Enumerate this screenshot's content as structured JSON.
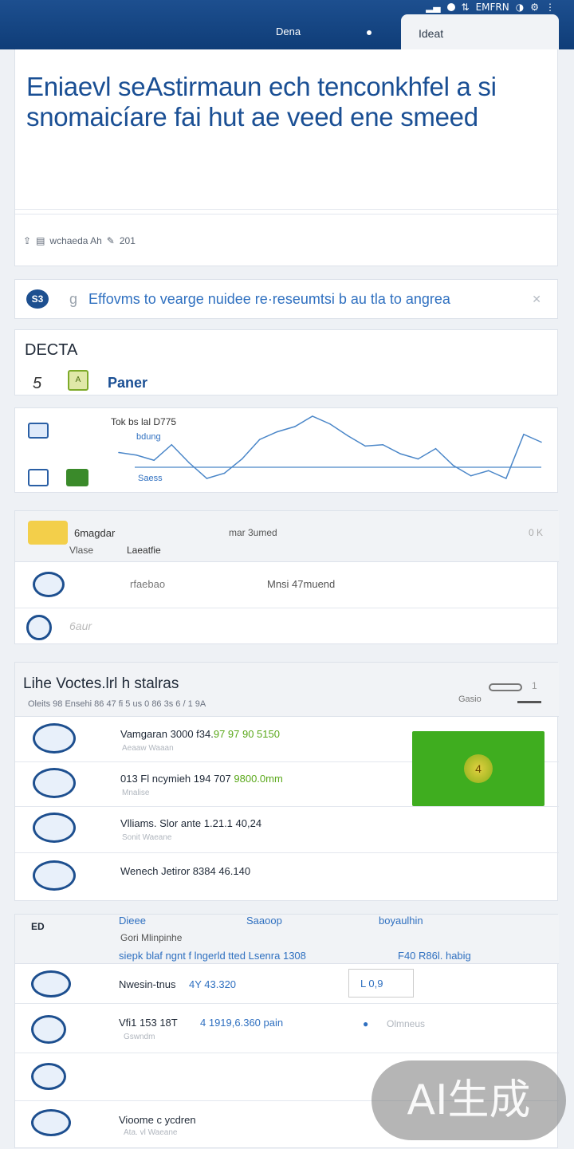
{
  "topbar": {
    "status_text": "EMFRN",
    "tab_demo": "Dena",
    "tab_active": "Ideat"
  },
  "hero": {
    "title": "Eniaevl seAstirmaun ech tenconkhfel a si snomaicíare fai hut ae veed ene smeed",
    "meta": "wchaeda Ah",
    "meta_count": "201"
  },
  "banner": {
    "icon": "S3",
    "g": "g",
    "text": "Effovms to vearge nuidee re·reseumtsi b au tla to angrea"
  },
  "delta": {
    "title": "DECTA",
    "count": "5",
    "panel_label": "Paner"
  },
  "mini_chart": {
    "label": "Tok bs lal D775",
    "sub": "bdung",
    "foot": "Saess",
    "chart_data": {
      "type": "line",
      "series": [
        {
          "values": [
            30,
            28,
            24,
            36,
            22,
            10,
            14,
            25,
            40,
            46,
            50,
            58,
            52,
            43,
            35,
            36,
            29,
            25,
            33,
            20,
            12,
            16,
            10,
            44,
            38
          ]
        }
      ]
    }
  },
  "filter": {
    "head_t1": "6magdar",
    "head_t2": "mar 3umed",
    "head_t3": "0 K",
    "head_t4": "Vlase",
    "head_t5": "Laeatfie",
    "row1_t1": "rfaebao",
    "row1_t2": "Mnsi 47muend",
    "row2_t1": "6aur"
  },
  "votes": {
    "title": "Lihe Voctes.lrl h stalras",
    "sub": "Oleits 98 Ensehi 86 47 fi 5 us 0 86 3s 6 / 1 9A",
    "count": "1",
    "goto": "Gasio",
    "rows": [
      {
        "name": "Vamgaran 3000  f34.",
        "value": "97 97 90 5150",
        "sub": "Aeaaw Waaan"
      },
      {
        "name": "013 Fl ncymieh  194 707 ",
        "value": "9800.0mm",
        "sub": "Mnalise"
      },
      {
        "name": "Vlliams. Slor ante  1.21.1 40,24",
        "value": "",
        "sub": "Sonit Waeane"
      },
      {
        "name": "Wenech Jetiror  8384 46.140",
        "value": "",
        "sub": ""
      }
    ],
    "button_glyph": "4"
  },
  "bottom": {
    "ed": "ED",
    "head_t1": "Dieee",
    "head_t2": "Saaoop",
    "head_t3": "boyaulhin",
    "head_t4": "Gori Mlinpinhe",
    "head_t5": "siepk blaf ngnt f lngerld tted Lsenra 1308",
    "head_t6": "F40 R86l. habig",
    "rows": [
      {
        "n1": "Nwesin-tnus",
        "n2": "4Y 43.320",
        "s1": "",
        "box": "L 0,9"
      },
      {
        "n1": "Vfi1 153 18T",
        "n2": "4 1919,6.360 pain",
        "s1": "Gswndm",
        "extra": "Olmneus"
      },
      {
        "n1": "",
        "n2": "",
        "s1": ""
      },
      {
        "n1": "Vioome c ycdren",
        "n2": "",
        "s1": "Ata. vl Waeane"
      }
    ]
  },
  "watermark": "AI生成"
}
